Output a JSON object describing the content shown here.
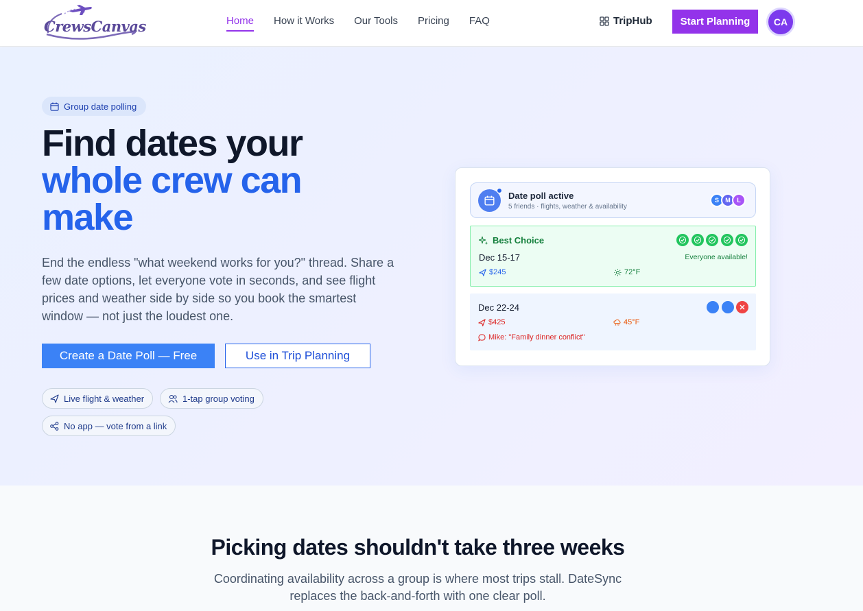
{
  "header": {
    "logo_text": "CrewsCanvas",
    "nav": [
      {
        "label": "Home",
        "active": true
      },
      {
        "label": "How it Works",
        "active": false
      },
      {
        "label": "Our Tools",
        "active": false
      },
      {
        "label": "Pricing",
        "active": false
      },
      {
        "label": "FAQ",
        "active": false
      }
    ],
    "triphub_label": "TripHub",
    "cta_label": "Start Planning",
    "avatar_initials": "CA"
  },
  "hero": {
    "badge": "Group date polling",
    "headline_line1": "Find dates your",
    "headline_line2": "whole crew can make",
    "lead": "End the endless \"what weekend works for you?\" thread. Share a few date options, let everyone vote in seconds, and see flight prices and weather side by side so you book the smartest window — not just the loudest one.",
    "primary_button": "Create a Date Poll — Free",
    "secondary_button": "Use in Trip Planning",
    "features": [
      "Live flight & weather",
      "1-tap group voting",
      "No app — vote from a link"
    ]
  },
  "poll_card": {
    "status_title": "Date poll active",
    "status_sub": "5 friends · flights, weather & availability",
    "participants": [
      "S",
      "M",
      "L"
    ],
    "option1": {
      "tag": "Best Choice",
      "dates": "Dec 15-17",
      "availability": "Everyone available!",
      "price": "$245",
      "temp": "72°F"
    },
    "option2": {
      "dates": "Dec 22-24",
      "price": "$425",
      "temp": "45°F",
      "note": "Mike: \"Family dinner conflict\""
    }
  },
  "section2": {
    "title": "Picking dates shouldn't take three weeks",
    "subtitle": "Coordinating availability across a group is where most trips stall. DateSync replaces the back-and-forth with one clear poll."
  },
  "colors": {
    "brand_purple": "#9333ea",
    "accent_blue": "#2563eb",
    "button_blue": "#3b82f6",
    "success_green": "#22c55e",
    "danger_red": "#ef4444"
  },
  "icons": {
    "badge": "calendar-icon",
    "triphub": "grid-icon",
    "features": [
      "plane-icon",
      "users-icon",
      "share-icon"
    ]
  }
}
